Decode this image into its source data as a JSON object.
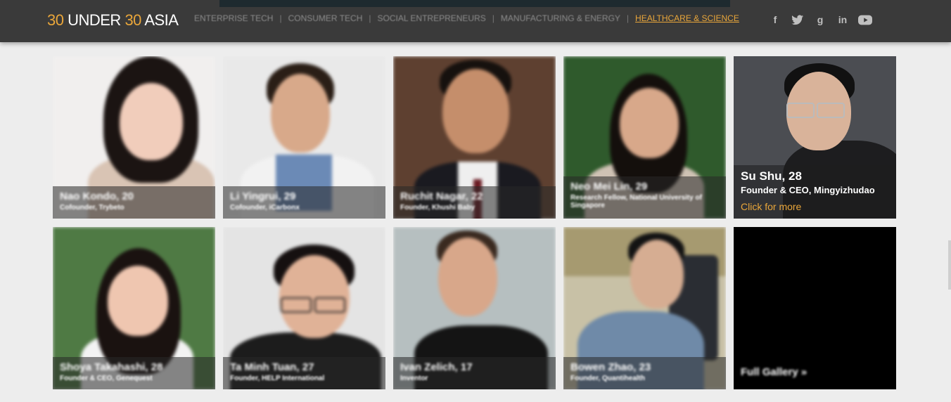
{
  "header": {
    "logo_num1": "30",
    "logo_word": " UNDER ",
    "logo_num2": "30",
    "logo_region": " ASIA",
    "nav": [
      {
        "label": "ENTERPRISE TECH"
      },
      {
        "label": "CONSUMER TECH"
      },
      {
        "label": "SOCIAL ENTREPRENEURS"
      },
      {
        "label": "MANUFACTURING & ENERGY"
      },
      {
        "label": "HEALTHCARE & SCIENCE"
      }
    ],
    "social": [
      {
        "icon": "facebook-icon",
        "glyph": "f"
      },
      {
        "icon": "twitter-icon",
        "glyph": "🐦"
      },
      {
        "icon": "google-plus-icon",
        "glyph": "g"
      },
      {
        "icon": "linkedin-icon",
        "glyph": "in"
      },
      {
        "icon": "youtube-icon",
        "glyph": "▶"
      }
    ]
  },
  "colors": {
    "accent": "#e9a63a",
    "header_bg": "#3a3a3a",
    "page_bg": "#ededed"
  },
  "people": [
    {
      "name": "Nao Kondo, 20",
      "role": "Cofounder, Trybeto"
    },
    {
      "name": "Li Yingrui, 29",
      "role": "Cofounder, iCarbonx"
    },
    {
      "name": "Ruchit Nagar, 22",
      "role": "Founder, Khushi Baby"
    },
    {
      "name": "Neo Mei Lin, 29",
      "role": "Research Fellow, National University of Singapore"
    },
    {
      "name": "Su Shu, 28",
      "role": "Founder & CEO, Mingyizhudao",
      "more": "Click for more"
    },
    {
      "name": "Shoya Takahashi, 28",
      "role": "Founder & CEO, Genequest"
    },
    {
      "name": "Ta Minh Tuan, 27",
      "role": "Founder, HELP International"
    },
    {
      "name": "Ivan Zelich, 17",
      "role": "Inventor"
    },
    {
      "name": "Bowen Zhao, 23",
      "role": "Founder, Quantihealth"
    }
  ],
  "gallery": {
    "label": "Full Gallery »"
  }
}
